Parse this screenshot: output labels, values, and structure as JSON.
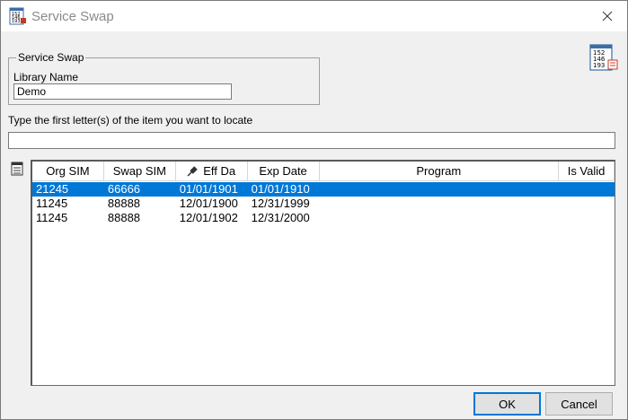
{
  "window": {
    "title": "Service Swap"
  },
  "group": {
    "legend": "Service Swap",
    "library_label": "Library Name",
    "library_value": "Demo"
  },
  "locate": {
    "label": "Type the first letter(s) of the item you want to locate",
    "value": ""
  },
  "icon_numbers": [
    "152",
    "146",
    "193"
  ],
  "grid": {
    "columns": [
      {
        "label": "Org SIM"
      },
      {
        "label": "Swap SIM"
      },
      {
        "label": "Eff Da",
        "icon": "pin-icon"
      },
      {
        "label": "Exp Date"
      },
      {
        "label": "Program"
      },
      {
        "label": "Is Valid"
      }
    ],
    "rows": [
      {
        "cells": [
          "21245",
          "66666",
          "01/01/1901",
          "01/01/1910",
          "",
          ""
        ],
        "selected": true
      },
      {
        "cells": [
          "11245",
          "88888",
          "12/01/1900",
          "12/31/1999",
          "",
          ""
        ],
        "selected": false
      },
      {
        "cells": [
          "11245",
          "88888",
          "12/01/1902",
          "12/31/2000",
          "",
          ""
        ],
        "selected": false
      }
    ]
  },
  "buttons": {
    "ok": "OK",
    "cancel": "Cancel"
  },
  "colors": {
    "selection": "#0078d7",
    "default_button_border": "#0078d7"
  }
}
